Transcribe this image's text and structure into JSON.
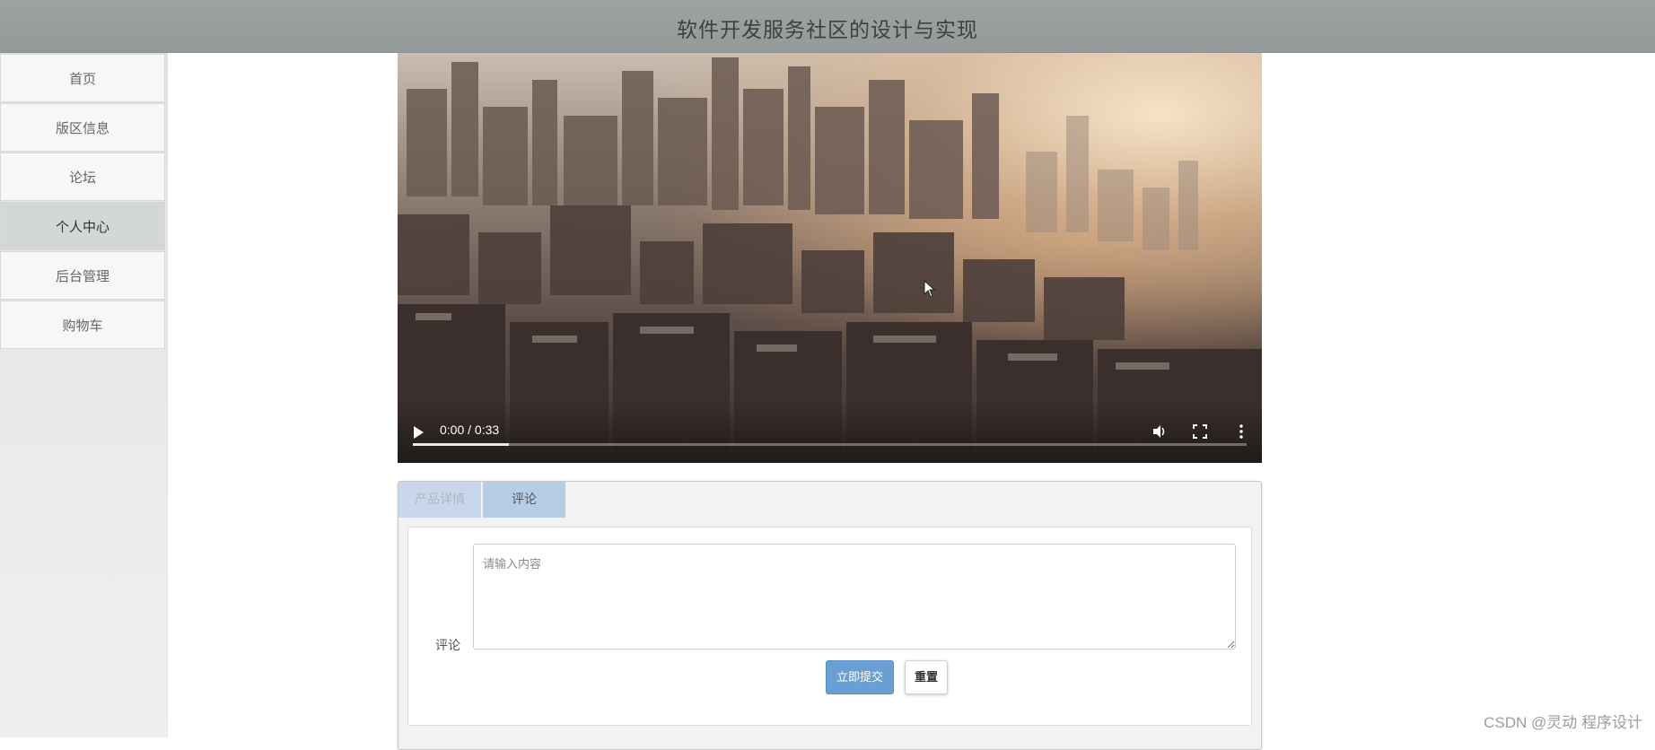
{
  "header": {
    "title": "软件开发服务社区的设计与实现"
  },
  "sidebar": {
    "items": [
      {
        "label": "首页"
      },
      {
        "label": "版区信息"
      },
      {
        "label": "论坛"
      },
      {
        "label": "个人中心"
      },
      {
        "label": "后台管理"
      },
      {
        "label": "购物车"
      }
    ],
    "active_index": 3
  },
  "video": {
    "time_display": "0:00 / 0:33",
    "progress_buffered": 0.115
  },
  "tabs": [
    {
      "label": "产品详情"
    },
    {
      "label": "评论"
    }
  ],
  "comment_form": {
    "label": "评论",
    "placeholder": "请输入内容",
    "submit_label": "立即提交",
    "reset_label": "重置"
  },
  "watermark": "CSDN @灵动 程序设计",
  "colors": {
    "header_bg": "#9da3a3",
    "submit_button": "#6a9fd4",
    "tab_active": "#b7cde5"
  }
}
